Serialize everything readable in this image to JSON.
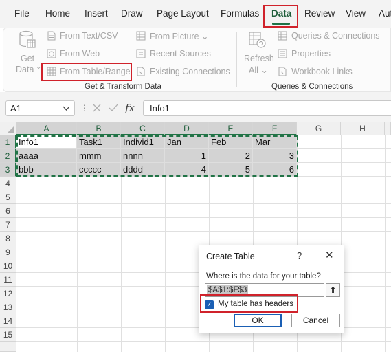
{
  "menu": {
    "tabs": [
      "File",
      "Home",
      "Insert",
      "Draw",
      "Page Layout",
      "Formulas",
      "Data",
      "Review",
      "View",
      "Aut"
    ],
    "active_tab": "Data"
  },
  "ribbon": {
    "get_data": {
      "label_line1": "Get",
      "label_line2": "Data",
      "arrow": "⌄"
    },
    "items_left": [
      "From Text/CSV",
      "From Web",
      "From Table/Range"
    ],
    "items_mid": [
      "From Picture ⌄",
      "Recent Sources",
      "Existing Connections"
    ],
    "group1_label": "Get & Transform Data",
    "refresh": {
      "label_line1": "Refresh",
      "label_line2": "All ⌄"
    },
    "items_right": [
      "Queries & Connections",
      "Properties",
      "Workbook Links"
    ],
    "group2_label": "Queries & Connections"
  },
  "formula_bar": {
    "name_box": "A1",
    "fx": "fx",
    "value": "Info1"
  },
  "grid": {
    "columns": [
      "A",
      "B",
      "C",
      "D",
      "E",
      "F",
      "G",
      "H"
    ],
    "rows": [
      "1",
      "2",
      "3",
      "4",
      "5",
      "6",
      "7",
      "8",
      "9",
      "10",
      "11",
      "12",
      "13",
      "14",
      "15"
    ],
    "cells": [
      [
        "Info1",
        "Task1",
        "Individ1",
        "Jan",
        "Feb",
        "Mar"
      ],
      [
        "aaaa",
        "mmm",
        "nnnn",
        "1",
        "2",
        "3"
      ],
      [
        "bbb",
        "ccccc",
        "dddd",
        "4",
        "5",
        "6"
      ]
    ]
  },
  "dialog": {
    "title": "Create Table",
    "help": "?",
    "close": "✕",
    "question": "Where is the data for your table?",
    "range": "$A$1:$F$3",
    "collapse_icon": "⬆",
    "checkbox_label": "My table has headers",
    "checkbox_checked": true,
    "ok": "OK",
    "cancel": "Cancel"
  },
  "colors": {
    "accent": "#217346",
    "highlight": "#d0222b",
    "checkbox": "#1a5fb4"
  }
}
